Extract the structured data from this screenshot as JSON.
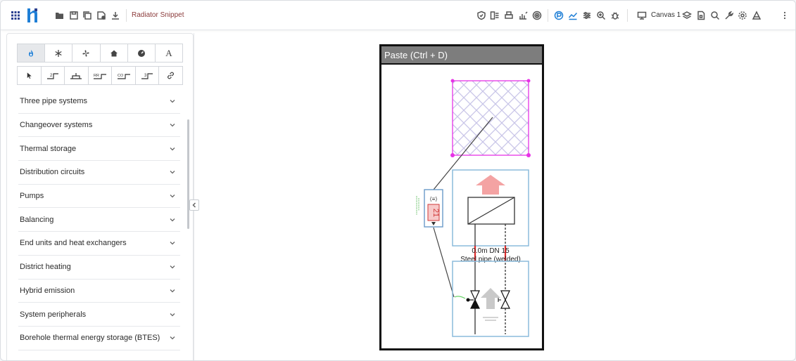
{
  "app": {
    "project_name": "Radiator Snippet",
    "canvas_label": "Canvas 1"
  },
  "toolbar_left_icons": [
    "apps-grid-icon",
    "logo-icon",
    "open-folder-icon",
    "save-icon",
    "copy-icon",
    "save-as-icon",
    "download-icon"
  ],
  "toolbar_right_icons": [
    "shield-icon",
    "calculate-icon",
    "print-icon",
    "report-icon",
    "target-icon",
    "pipe-sizing-icon",
    "chart-icon",
    "sliders-icon",
    "zoom-icon",
    "bug-icon",
    "canvas-icon",
    "layers-icon",
    "document-icon",
    "search-icon",
    "wrench-icon",
    "settings-icon",
    "compliance-icon",
    "more-icon"
  ],
  "colors": {
    "accent_blue": "#1f7fd6",
    "project_name": "#8b3b3b",
    "magenta": "#e633e6",
    "light_blue": "#7fb2d6",
    "red_arrow": "#f4a3a3",
    "grey_arrow": "#c9c9c9"
  },
  "sidebar": {
    "category_tabs": [
      {
        "icon": "flame-icon",
        "label": "",
        "active": true
      },
      {
        "icon": "snowflake-icon",
        "label": "",
        "active": false
      },
      {
        "icon": "fan-icon",
        "label": "",
        "active": false
      },
      {
        "icon": "house-icon",
        "label": "",
        "active": false
      },
      {
        "icon": "gauge-icon",
        "label": "",
        "active": false
      },
      {
        "icon": "text-icon",
        "label": "A",
        "active": false
      }
    ],
    "tool_buttons": [
      {
        "icon": "pointer-icon",
        "label": ""
      },
      {
        "icon": "pipe-2-icon",
        "label": "2"
      },
      {
        "icon": "pipe-branch-icon",
        "label": ""
      },
      {
        "icon": "pipe-rr-icon",
        "label": "RR"
      },
      {
        "icon": "pipe-co-icon",
        "label": "CO"
      },
      {
        "icon": "pipe-3-icon",
        "label": "3"
      },
      {
        "icon": "link-icon",
        "label": ""
      }
    ],
    "categories": [
      "Three pipe systems",
      "Changeover systems",
      "Thermal storage",
      "Distribution circuits",
      "Pumps",
      "Balancing",
      "End units and heat exchangers",
      "District heating",
      "Hybrid emission",
      "System peripherals",
      "Borehole thermal energy storage (BTES)"
    ]
  },
  "snippet": {
    "header": "Paste (Ctrl + D)",
    "pipe_length_label": "0.0m DN 15",
    "pipe_material_label": "Steel pipe (welded)",
    "controller_value": "21"
  }
}
